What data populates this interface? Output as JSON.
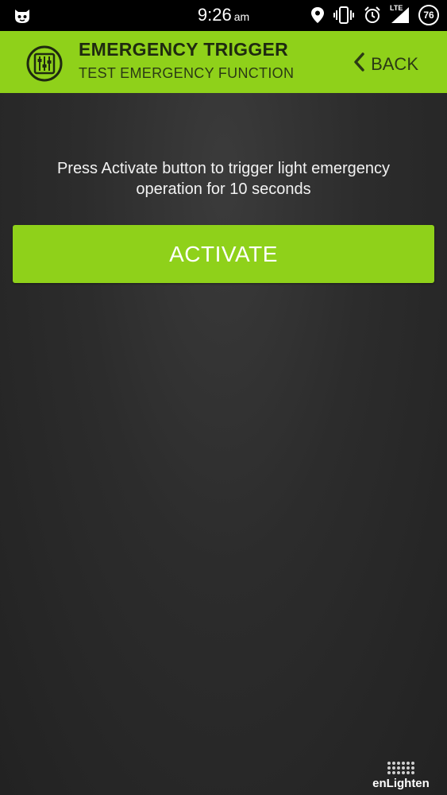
{
  "status_bar": {
    "time": "9:26",
    "ampm": "am",
    "network": "LTE",
    "battery_level": "76",
    "icons": [
      "app-icon",
      "location-icon",
      "vibrate-icon",
      "alarm-icon",
      "signal-icon",
      "battery-icon"
    ]
  },
  "header": {
    "title": "EMERGENCY TRIGGER",
    "subtitle": "TEST EMERGENCY FUNCTION",
    "back_label": "BACK",
    "logo_icon": "sliders-icon",
    "background": "#8fd11a"
  },
  "main": {
    "instructions": "Press Activate button to trigger light emergency operation for 10 seconds",
    "activate_label": "ACTIVATE",
    "accent": "#8fd11a"
  },
  "brand": {
    "word": "enLighten"
  }
}
